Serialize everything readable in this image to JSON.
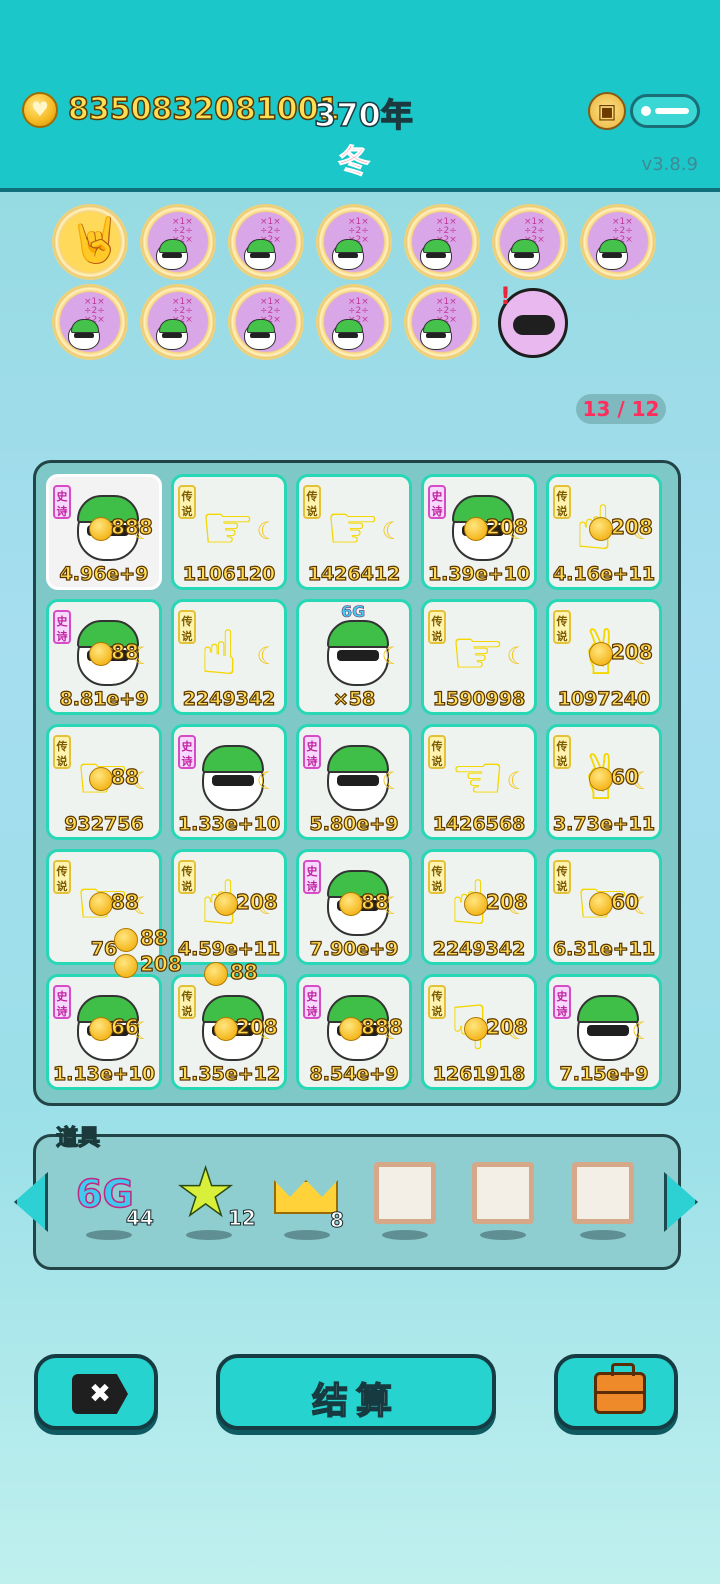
{
  "header": {
    "money": "8350832081001",
    "year": "370年",
    "season": "冬",
    "version": "v3.8.9"
  },
  "badges_counter": "13 / 12",
  "board": {
    "cells": [
      {
        "rarity": "史诗",
        "type": "face",
        "value": "4.96e+9",
        "pop": "888"
      },
      {
        "rarity": "传说",
        "type": "hand",
        "glyph": "☞",
        "value": "1106120",
        "pop": ""
      },
      {
        "rarity": "传说",
        "type": "hand",
        "glyph": "☞",
        "value": "1426412",
        "pop": ""
      },
      {
        "rarity": "史诗",
        "type": "face",
        "value": "1.39e+10",
        "pop": "208"
      },
      {
        "rarity": "传说",
        "type": "hand",
        "glyph": "☝",
        "value": "4.16e+11",
        "pop": "208"
      },
      {
        "rarity": "史诗",
        "type": "face",
        "value": "8.81e+9",
        "pop": "88"
      },
      {
        "rarity": "传说",
        "type": "hand",
        "glyph": "☝",
        "value": "2249342",
        "pop": ""
      },
      {
        "rarity": "",
        "type": "face",
        "value": "×58",
        "pop": "",
        "tag": "6G"
      },
      {
        "rarity": "传说",
        "type": "hand",
        "glyph": "☞",
        "value": "1590998",
        "pop": ""
      },
      {
        "rarity": "传说",
        "type": "hand",
        "glyph": "✌",
        "value": "1097240",
        "pop": "208"
      },
      {
        "rarity": "传说",
        "type": "hand",
        "glyph": "☞",
        "value": "932756",
        "pop": "88"
      },
      {
        "rarity": "史诗",
        "type": "face",
        "value": "1.33e+10",
        "pop": ""
      },
      {
        "rarity": "史诗",
        "type": "face",
        "value": "5.80e+9",
        "pop": ""
      },
      {
        "rarity": "传说",
        "type": "hand",
        "glyph": "☜",
        "value": "1426568",
        "pop": ""
      },
      {
        "rarity": "传说",
        "type": "hand",
        "glyph": "✌",
        "value": "3.73e+11",
        "pop": "60"
      },
      {
        "rarity": "传说",
        "type": "hand",
        "glyph": "☞",
        "value": "76",
        "pop": "88"
      },
      {
        "rarity": "传说",
        "type": "hand",
        "glyph": "☝",
        "value": "4.59e+11",
        "pop": "208"
      },
      {
        "rarity": "史诗",
        "type": "face",
        "value": "7.90e+9",
        "pop": "88"
      },
      {
        "rarity": "传说",
        "type": "hand",
        "glyph": "☝",
        "value": "2249342",
        "pop": "208"
      },
      {
        "rarity": "传说",
        "type": "hand",
        "glyph": "☞",
        "value": "6.31e+11",
        "pop": "60"
      },
      {
        "rarity": "史诗",
        "type": "face",
        "value": "1.13e+10",
        "pop": "66"
      },
      {
        "rarity": "传说",
        "type": "face",
        "value": "1.35e+12",
        "pop": "208"
      },
      {
        "rarity": "史诗",
        "type": "face",
        "value": "8.54e+9",
        "pop": "888"
      },
      {
        "rarity": "传说",
        "type": "hand",
        "glyph": "☟",
        "value": "1261918",
        "pop": "208"
      },
      {
        "rarity": "史诗",
        "type": "face",
        "value": "7.15e+9",
        "pop": ""
      }
    ],
    "floating_pops": [
      "88",
      "208",
      "88"
    ]
  },
  "items": {
    "label": "道具",
    "slots": [
      {
        "icon": "6G",
        "count": "44"
      },
      {
        "icon": "★",
        "count": "12"
      },
      {
        "icon": "crown",
        "count": "8"
      },
      {
        "icon": "empty",
        "count": ""
      },
      {
        "icon": "empty",
        "count": ""
      },
      {
        "icon": "empty",
        "count": ""
      }
    ]
  },
  "buttons": {
    "close_icon": "✖",
    "settle": "结算"
  },
  "colors": {
    "accent": "#1cc7c9",
    "cell_border": "#28d7b5",
    "money": "#ffdd55",
    "season": "#ff3b6b"
  }
}
